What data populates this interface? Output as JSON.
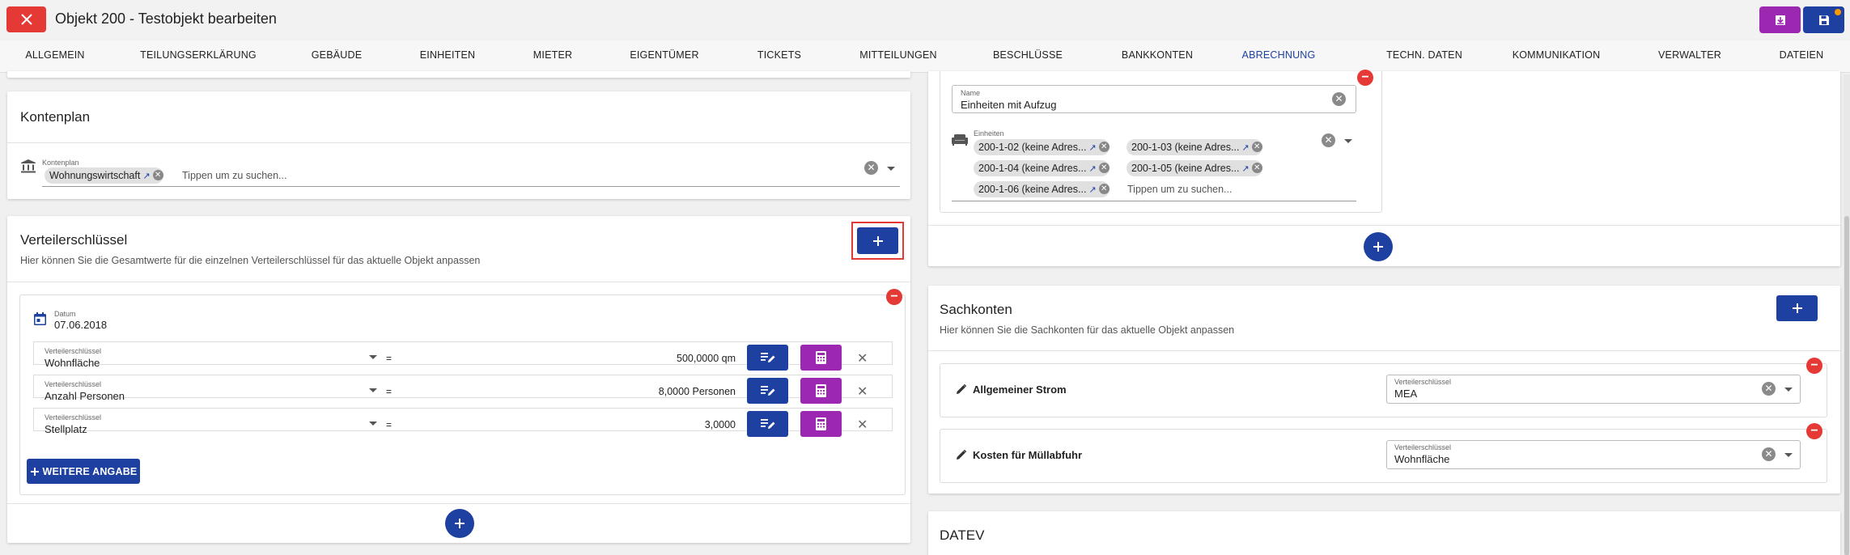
{
  "header": {
    "title": "Objekt 200 - Testobjekt bearbeiten"
  },
  "tabs": [
    {
      "label": "Allgemein"
    },
    {
      "label": "Teilungserklärung"
    },
    {
      "label": "Gebäude"
    },
    {
      "label": "Einheiten"
    },
    {
      "label": "Mieter"
    },
    {
      "label": "Eigentümer"
    },
    {
      "label": "Tickets"
    },
    {
      "label": "Mitteilungen"
    },
    {
      "label": "Beschlüsse"
    },
    {
      "label": "Bankkonten"
    },
    {
      "label": "Abrechnung"
    },
    {
      "label": "Techn. Daten"
    },
    {
      "label": "Kommunikation"
    },
    {
      "label": "Verwalter"
    },
    {
      "label": "Dateien"
    }
  ],
  "active_tab": "Abrechnung",
  "kontenplan": {
    "title": "Kontenplan",
    "field_label": "Kontenplan",
    "chip": "Wohnungswirtschaft",
    "placeholder": "Tippen um zu suchen..."
  },
  "verteiler": {
    "title": "Verteilerschlüssel",
    "subtitle": "Hier können Sie die Gesamtwerte für die einzelnen Verteilerschlüssel für das aktuelle Objekt anpassen",
    "date_label": "Datum",
    "date_value": "07.06.2018",
    "row_label": "Verteilerschlüssel",
    "equals": "=",
    "rows": [
      {
        "name": "Wohnfläche",
        "value": "500,0000 qm"
      },
      {
        "name": "Anzahl Personen",
        "value": "8,0000 Personen"
      },
      {
        "name": "Stellplatz",
        "value": "3,0000"
      }
    ],
    "add_more_label": "WEITERE ANGABE"
  },
  "gruppe": {
    "name_label": "Name",
    "name_value": "Einheiten mit Aufzug",
    "einheiten_label": "Einheiten",
    "chips": [
      "200-1-02 (keine Adres...",
      "200-1-03 (keine Adres...",
      "200-1-04 (keine Adres...",
      "200-1-05 (keine Adres...",
      "200-1-06 (keine Adres..."
    ],
    "placeholder": "Tippen um zu suchen..."
  },
  "sachkonten": {
    "title": "Sachkonten",
    "subtitle": "Hier können Sie die Sachkonten für das aktuelle Objekt anpassen",
    "field_label": "Verteilerschlüssel",
    "items": [
      {
        "name": "Allgemeiner Strom",
        "value": "MEA"
      },
      {
        "name": "Kosten für Müllabfuhr",
        "value": "Wohnfläche"
      }
    ]
  },
  "datev": {
    "title": "DATEV"
  },
  "colors": {
    "primary": "#1e40a0",
    "danger": "#e53935",
    "accent": "#9c27b0"
  }
}
